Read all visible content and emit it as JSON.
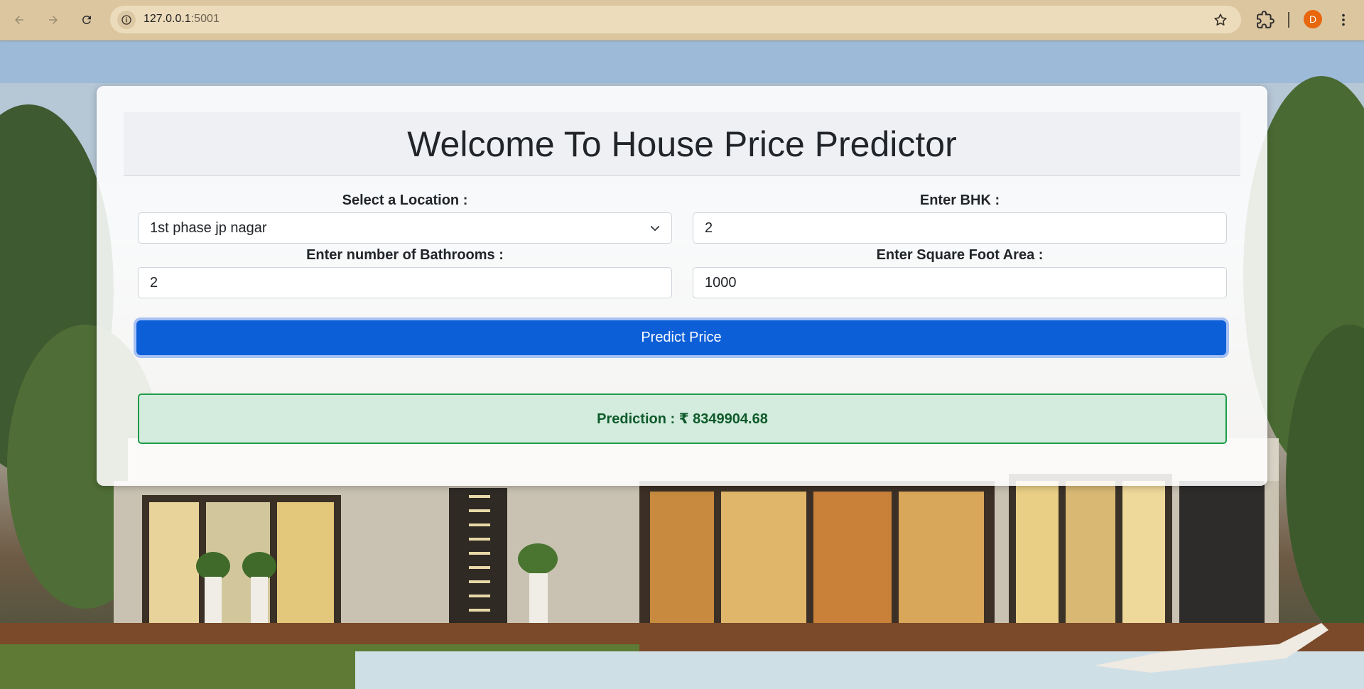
{
  "browser": {
    "url_host": "127.0.0.1",
    "url_port": ":5001",
    "profile_initial": "D"
  },
  "page": {
    "title": "Welcome To House Price Predictor",
    "location_label": "Select a Location :",
    "location_value": "1st phase jp nagar",
    "bhk_label": "Enter BHK :",
    "bhk_value": "2",
    "bath_label": "Enter number of Bathrooms :",
    "bath_value": "2",
    "sqft_label": "Enter Square Foot Area :",
    "sqft_value": "1000",
    "predict_button": "Predict Price",
    "prediction_text": "Prediction : ₹ 8349904.68"
  },
  "colors": {
    "chrome_bg": "#dcc6a0",
    "button_blue": "#0d5fd8",
    "result_green_bg": "#d3ecdd",
    "result_green_border": "#1f9b48",
    "avatar_orange": "#e8660c"
  },
  "icons": [
    "back-arrow-icon",
    "forward-arrow-icon",
    "reload-icon",
    "site-info-icon",
    "bookmark-star-icon",
    "extensions-icon",
    "kebab-menu-icon",
    "chevron-down-icon"
  ]
}
